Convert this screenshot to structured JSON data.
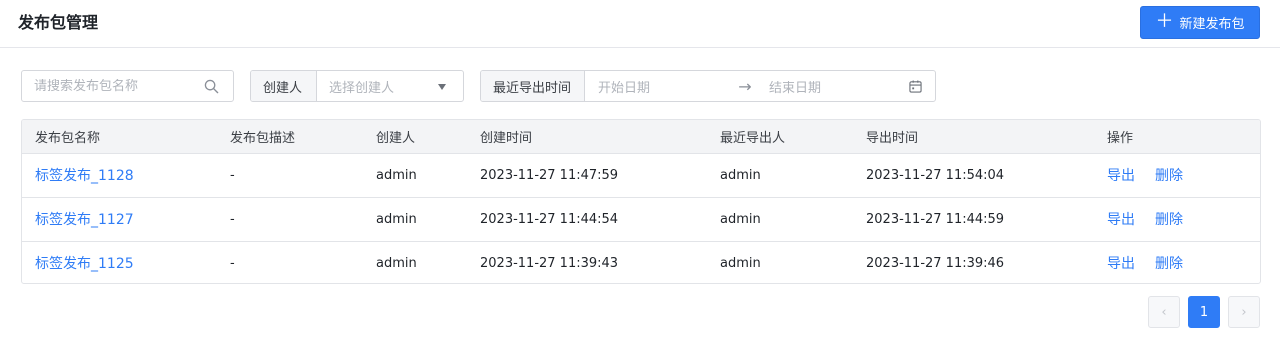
{
  "header": {
    "title": "发布包管理",
    "new_button": {
      "icon": "plus-icon",
      "label": "新建发布包"
    }
  },
  "filters": {
    "search": {
      "placeholder": "请搜索发布包名称",
      "value": "",
      "icon": "search-icon"
    },
    "creator": {
      "label": "创建人",
      "placeholder": "选择创建人",
      "icon": "caret-down-icon"
    },
    "export_time": {
      "label": "最近导出时间",
      "start_placeholder": "开始日期",
      "separator": "→",
      "end_placeholder": "结束日期",
      "icon": "calendar-icon"
    }
  },
  "table": {
    "columns": [
      "发布包名称",
      "发布包描述",
      "创建人",
      "创建时间",
      "最近导出人",
      "导出时间",
      "操作"
    ],
    "rows": [
      {
        "name": "标签发布_1128",
        "desc": "-",
        "creator": "admin",
        "created_at": "2023-11-27 11:47:59",
        "exporter": "admin",
        "exported_at": "2023-11-27 11:54:04"
      },
      {
        "name": "标签发布_1127",
        "desc": "-",
        "creator": "admin",
        "created_at": "2023-11-27 11:44:54",
        "exporter": "admin",
        "exported_at": "2023-11-27 11:44:59"
      },
      {
        "name": "标签发布_1125",
        "desc": "-",
        "creator": "admin",
        "created_at": "2023-11-27 11:39:43",
        "exporter": "admin",
        "exported_at": "2023-11-27 11:39:46"
      }
    ],
    "actions": {
      "export": "导出",
      "delete": "删除"
    }
  },
  "pagination": {
    "prev": "‹",
    "current_page": "1",
    "next": "›"
  },
  "colors": {
    "accent": "#2f7cf6",
    "header_bg": "#f3f4f6",
    "border": "#e2e4e8"
  }
}
